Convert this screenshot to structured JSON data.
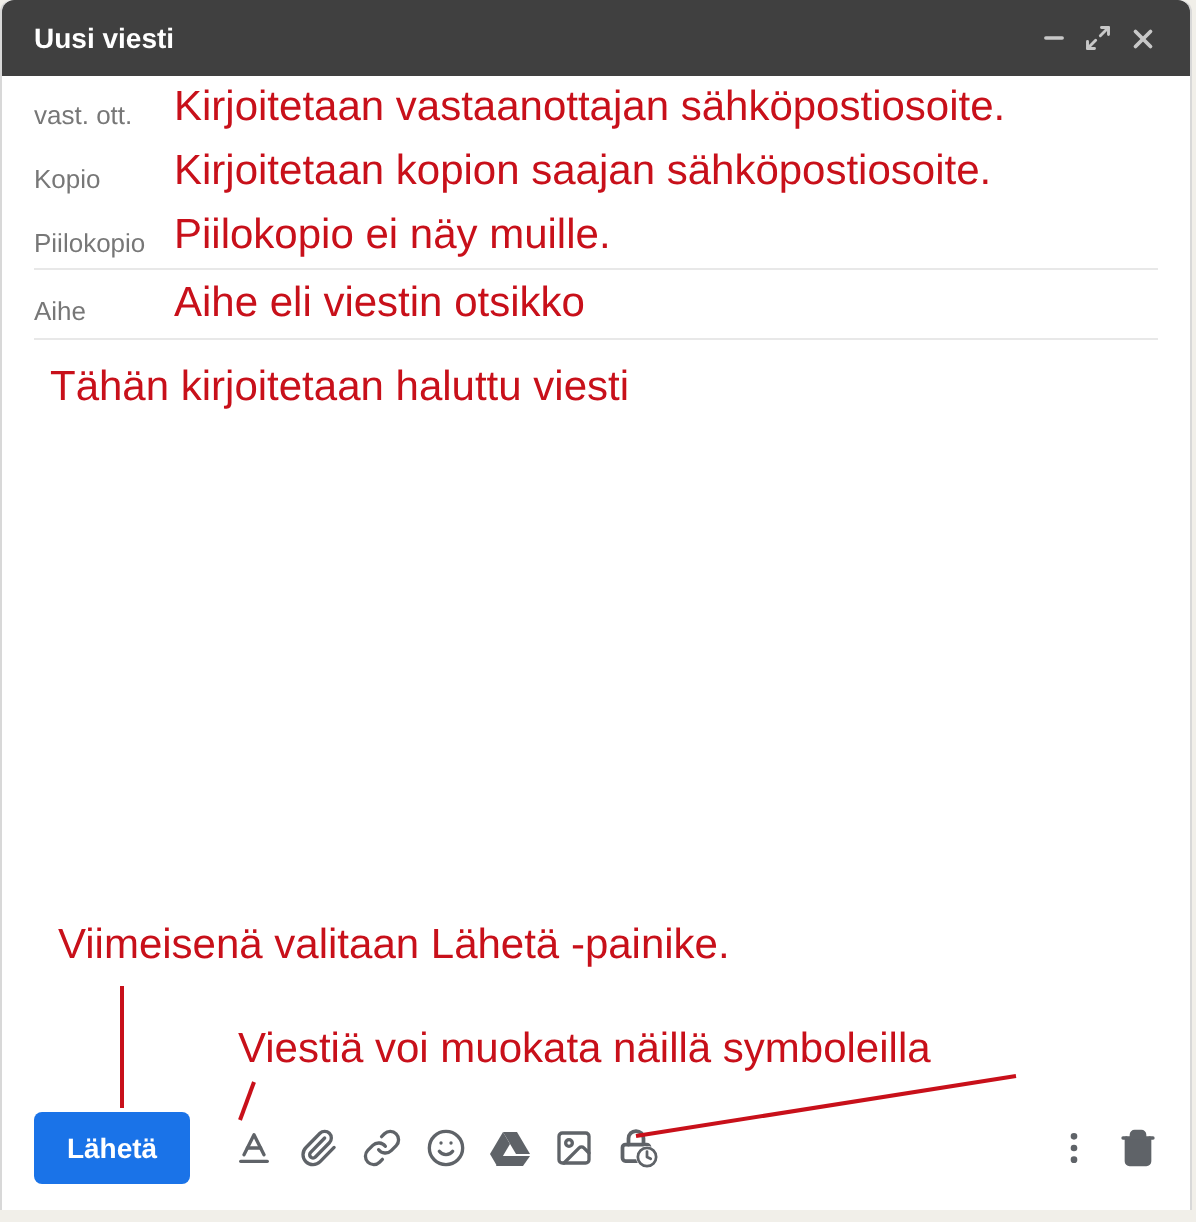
{
  "window": {
    "title": "Uusi viesti"
  },
  "fields": [
    {
      "kind": "recipient",
      "label": "vast. ott.",
      "annotation": "Kirjoitetaan vastaanottajan sähköpostiosoite."
    },
    {
      "kind": "recipient",
      "label": "Kopio",
      "annotation": "Kirjoitetaan kopion saajan sähköpostiosoite."
    },
    {
      "kind": "recipient",
      "label": "Piilokopio",
      "annotation": "Piilokopio ei näy muille."
    },
    {
      "kind": "subject",
      "label": "Aihe",
      "annotation": "Aihe eli viestin otsikko"
    }
  ],
  "body": {
    "annotation": "Tähän kirjoitetaan haluttu viesti"
  },
  "send_annotation": "Viimeisenä valitaan Lähetä -painike.",
  "toolbar_annotation": "Viestiä voi muokata näillä symboleilla",
  "send_button": "Lähetä"
}
